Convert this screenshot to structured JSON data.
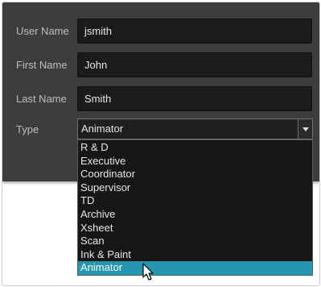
{
  "form": {
    "fields": [
      {
        "label": "User Name",
        "value": "jsmith"
      },
      {
        "label": "First Name",
        "value": "John"
      },
      {
        "label": "Last Name",
        "value": "Smith"
      }
    ],
    "type": {
      "label": "Type",
      "selected": "Animator",
      "options": [
        "R & D",
        "Executive",
        "Coordinator",
        "Supervisor",
        "TD",
        "Archive",
        "Xsheet",
        "Scan",
        "Ink & Paint",
        "Animator"
      ],
      "highlighted_option": "Animator"
    }
  },
  "colors": {
    "dialog_background": "#3d3d3d",
    "input_background": "#1b1b1b",
    "highlight": "#2496b0",
    "label_text": "#bdbdbd"
  },
  "icons": {
    "dropdown": "chevron-down-icon",
    "pointer": "mouse-pointer-icon"
  }
}
